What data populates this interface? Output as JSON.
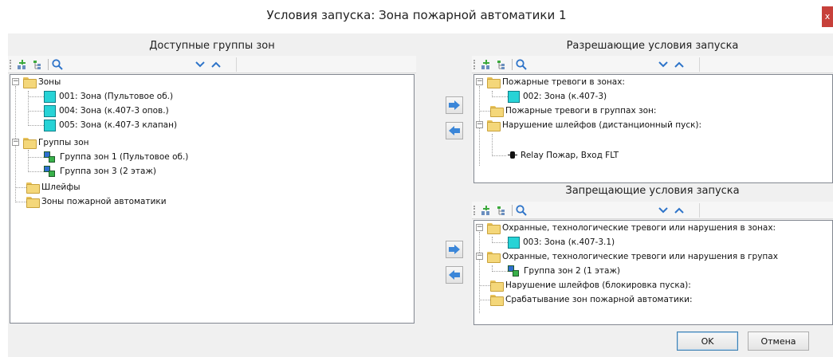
{
  "window": {
    "title": "Условия запуска: Зона пожарной автоматики 1",
    "close_glyph": "x"
  },
  "left_panel": {
    "title": "Доступные группы зон",
    "toolbar": {
      "icons": [
        "add-node-icon",
        "add-child-icon",
        "search-icon",
        "chevron-down-icon",
        "chevron-up-icon"
      ]
    },
    "tree": [
      {
        "label": "Зоны",
        "icon": "folder-open-icon",
        "expander": "−"
      },
      {
        "label": "001: Зона (Пультовое об.)",
        "icon": "zone-icon"
      },
      {
        "label": "004: Зона (к.407-3 опов.)",
        "icon": "zone-icon"
      },
      {
        "label": "005: Зона (к.407-3 клапан)",
        "icon": "zone-icon"
      },
      {
        "label": "Группы зон",
        "icon": "folder-open-icon",
        "expander": "−"
      },
      {
        "label": "Группа зон 1 (Пультовое об.)",
        "icon": "zone-group-icon"
      },
      {
        "label": "Группа зон 3 (2 этаж)",
        "icon": "zone-group-icon"
      },
      {
        "label": "Шлейфы",
        "icon": "folder-icon"
      },
      {
        "label": "Зоны пожарной автоматики",
        "icon": "folder-icon"
      }
    ]
  },
  "allow_panel": {
    "title": "Разрешающие условия запуска",
    "tree": [
      {
        "label": "Пожарные тревоги в зонах:",
        "icon": "folder-open-icon",
        "expander": "−"
      },
      {
        "label": "002: Зона (к.407-3)",
        "icon": "zone-icon"
      },
      {
        "label": "Пожарные тревоги в группах зон:",
        "icon": "folder-icon"
      },
      {
        "label": "Нарушение шлейфов (дистанционный пуск):",
        "icon": "folder-open-icon",
        "expander": "−"
      },
      {
        "label": "Relay Пожар, Вход FLT",
        "icon": "relay-icon"
      }
    ]
  },
  "deny_panel": {
    "title": "Запрещающие условия запуска",
    "tree": [
      {
        "label": "Охранные, технологические тревоги или нарушения в зонах:",
        "icon": "folder-open-icon",
        "expander": "−"
      },
      {
        "label": "003: Зона (к.407-3.1)",
        "icon": "zone-icon"
      },
      {
        "label": "Охранные, технологические тревоги или нарушения в групах",
        "icon": "folder-open-icon",
        "expander": "−"
      },
      {
        "label": "Группа зон 2 (1 этаж)",
        "icon": "zone-group-icon"
      },
      {
        "label": "Нарушение шлейфов (блокировка пуска):",
        "icon": "folder-icon"
      },
      {
        "label": "Срабатывание зон пожарной автоматики:",
        "icon": "folder-icon"
      }
    ]
  },
  "buttons": {
    "ok": "OK",
    "cancel": "Отмена"
  },
  "colors": {
    "zone_fill": "#27d3d6",
    "arrow": "#3b86d8",
    "folder": "#f4d77a",
    "close": "#c7403a"
  }
}
